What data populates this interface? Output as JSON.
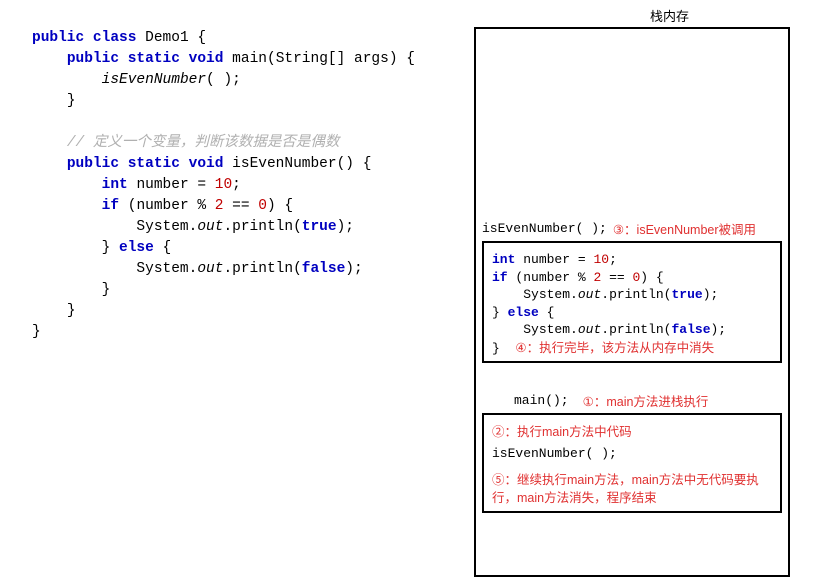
{
  "code": {
    "line1": {
      "kw_public": "public",
      "kw_class": "class",
      "classname": "Demo1",
      "brace": "{"
    },
    "line2": {
      "kw_public": "public",
      "kw_static": "static",
      "kw_void": "void",
      "method": "main",
      "args": "String[] args",
      "brace": "{"
    },
    "line3": {
      "call": "isEvenNumber",
      "parens": "( );"
    },
    "line4": {
      "brace": "}"
    },
    "line5": {
      "comment": "// 定义一个变量，判断该数据是否是偶数"
    },
    "line6": {
      "kw_public": "public",
      "kw_static": "static",
      "kw_void": "void",
      "method": "isEvenNumber",
      "parens": "()",
      "brace": "{"
    },
    "line7": {
      "kw_int": "int",
      "name": "number",
      "eq": "=",
      "val": "10",
      "semi": ";"
    },
    "line8": {
      "kw_if": "if",
      "open": "(",
      "expr_a": "number % ",
      "expr_num": "2",
      "expr_b": " == ",
      "expr_zero": "0",
      "close": ")",
      "brace": "{"
    },
    "line9": {
      "obj": "System",
      "dot1": ".",
      "field": "out",
      "dot2": ".",
      "fn": "println",
      "open": "(",
      "val": "true",
      "close": ");"
    },
    "line10": {
      "close": "}",
      "kw_else": "else",
      "brace": "{"
    },
    "line11": {
      "obj": "System",
      "dot1": ".",
      "field": "out",
      "dot2": ".",
      "fn": "println",
      "open": "(",
      "val": "false",
      "close": ");"
    },
    "line12": {
      "brace": "}"
    },
    "line13": {
      "brace": "}"
    },
    "line14": {
      "brace": "}"
    }
  },
  "stack": {
    "title": "栈内存",
    "callsite1": {
      "text": "isEvenNumber( );",
      "circ": "③",
      "note": "：isEvenNumber被调用"
    },
    "frame_top": {
      "l1": {
        "kw_int": "int",
        "name": "number",
        "eq": "=",
        "val": "10",
        "semi": ";"
      },
      "l2": {
        "kw_if": "if",
        "open": "(",
        "expr_a": "number % ",
        "expr_num": "2",
        "expr_b": " == ",
        "expr_zero": "0",
        "close": ")",
        "brace": "{"
      },
      "l3": {
        "obj": "System",
        "dot1": ".",
        "field": "out",
        "dot2": ".",
        "fn": "println",
        "open": "(",
        "val": "true",
        "close": ");"
      },
      "l4": {
        "close": "}",
        "kw_else": "else",
        "brace": "{"
      },
      "l5": {
        "obj": "System",
        "dot1": ".",
        "field": "out",
        "dot2": ".",
        "fn": "println",
        "open": "(",
        "val": "false",
        "close": ");"
      },
      "l6_brace": "}",
      "l6_circ": "④",
      "l6_note": "：执行完毕，该方法从内存中消失"
    },
    "callsite2": {
      "text": "main();",
      "circ": "①",
      "note": "：main方法进栈执行"
    },
    "frame_bottom": {
      "l1_circ": "②",
      "l1_note": "：执行main方法中代码",
      "l2_call": "isEvenNumber( );",
      "l3_circ": "⑤",
      "l3_note": "：继续执行main方法，main方法中无代码要执行，main方法消失，程序结束"
    }
  }
}
